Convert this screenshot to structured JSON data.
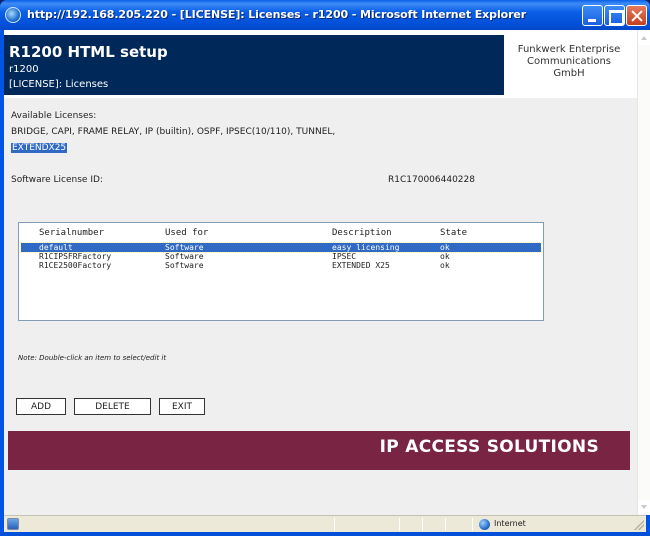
{
  "window": {
    "title": "http://192.168.205.220 - [LICENSE]: Licenses - r1200 - Microsoft Internet Explorer"
  },
  "header": {
    "title": "R1200 HTML setup",
    "subtitle1": "r1200",
    "subtitle2": "[LICENSE]: Licenses",
    "company_line1": "Funkwerk Enterprise",
    "company_line2": "Communications",
    "company_line3": "GmbH"
  },
  "licenses": {
    "label": "Available Licenses:",
    "list": "BRIDGE, CAPI, FRAME RELAY, IP (builtin), OSPF, IPSEC(10/110), TUNNEL,",
    "highlighted": "EXTENDX25"
  },
  "software_license": {
    "label": "Software License ID:",
    "value": "R1C170006440228"
  },
  "table": {
    "columns": [
      "Serialnumber",
      "Used for",
      "Description",
      "State"
    ],
    "rows": [
      {
        "serial": "default",
        "used_for": "Software",
        "description": "easy licensing",
        "state": "ok",
        "selected": true
      },
      {
        "serial": "R1CIPSFRFactory",
        "used_for": "Software",
        "description": "IPSEC",
        "state": "ok",
        "selected": false
      },
      {
        "serial": "R1CE2500Factory",
        "used_for": "Software",
        "description": "EXTENDED X25",
        "state": "ok",
        "selected": false
      }
    ]
  },
  "note": "Note: Double-click an item to select/edit it",
  "buttons": {
    "add": "ADD",
    "delete": "DELETE",
    "exit": "EXIT"
  },
  "banner": {
    "text": "IP ACCESS SOLUTIONS",
    "color": "#7a2443"
  },
  "statusbar": {
    "zone": "Internet"
  },
  "colors": {
    "header_blue": "#002959",
    "selection": "#316ac5",
    "titlebar": "#0450d8"
  },
  "icons": {
    "title": "ie-icon",
    "status": "page-icon",
    "zone": "globe-icon"
  }
}
